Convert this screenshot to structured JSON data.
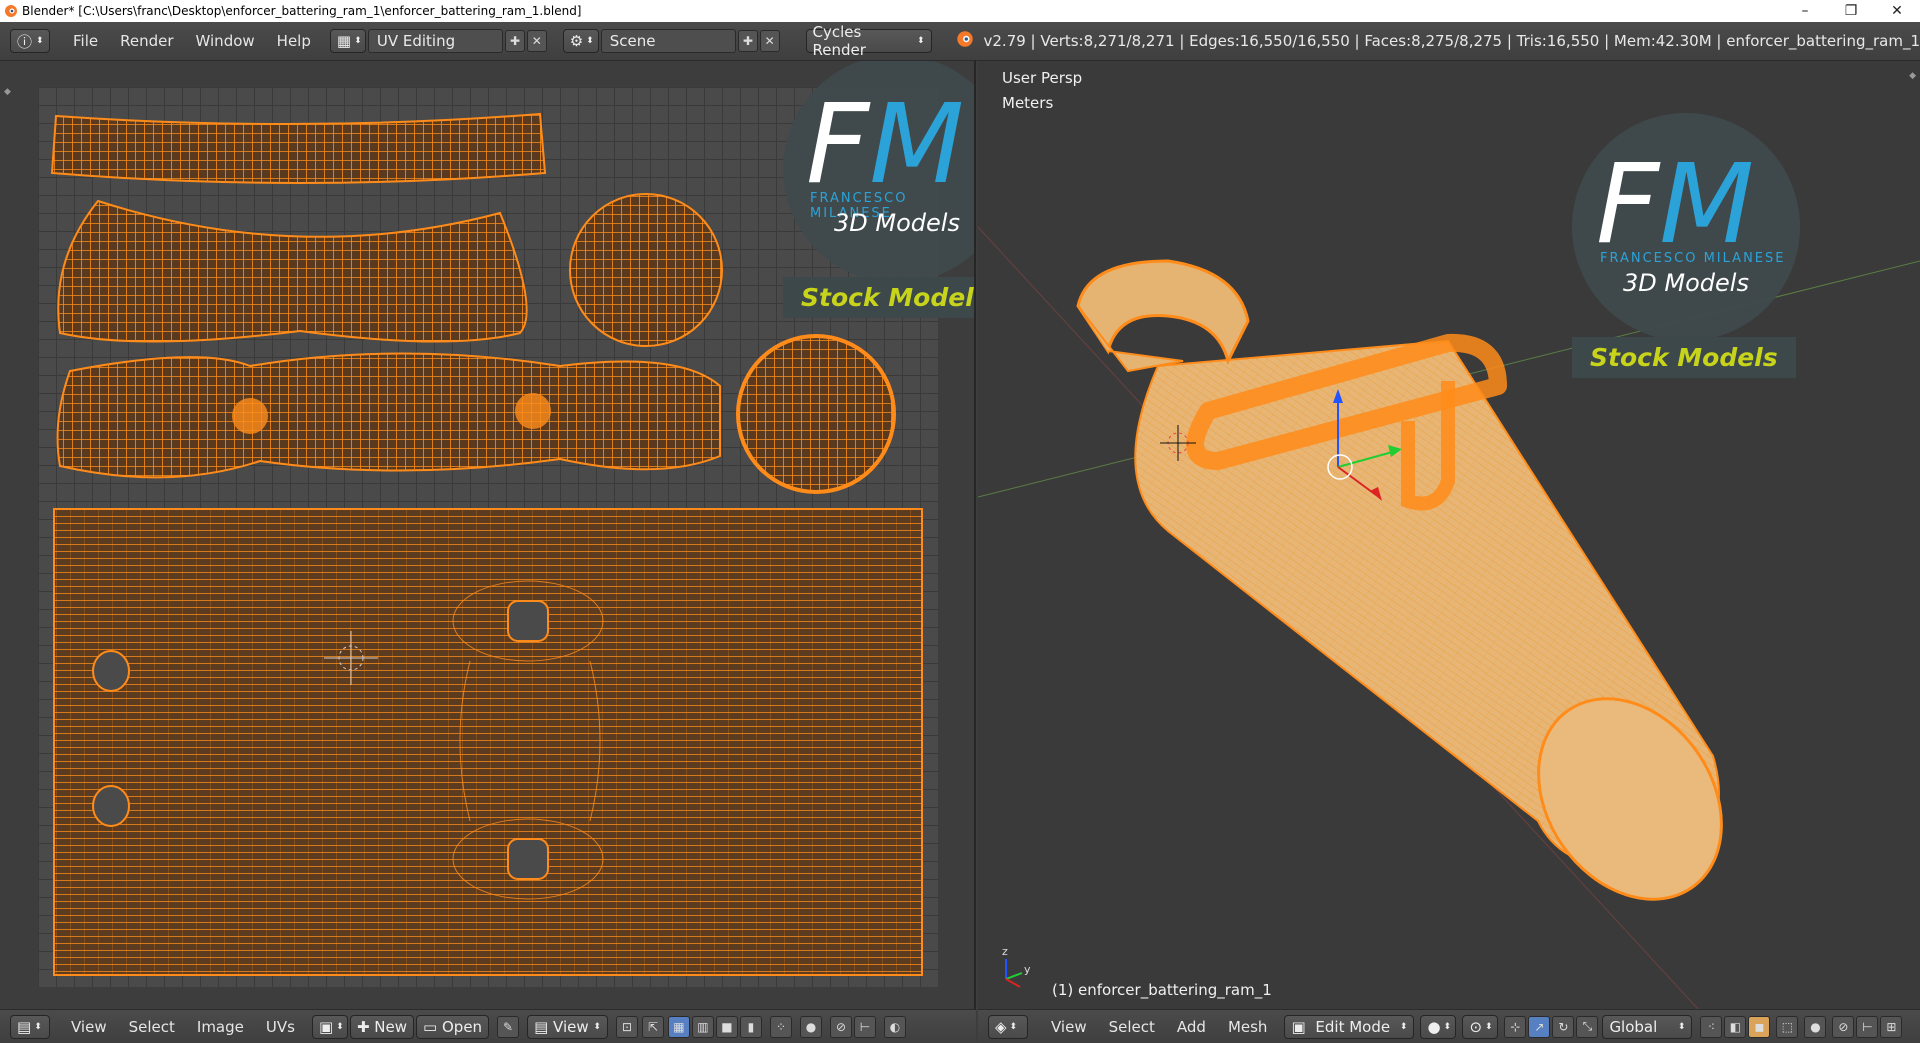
{
  "window": {
    "title": "Blender* [C:\\Users\\franc\\Desktop\\enforcer_battering_ram_1\\enforcer_battering_ram_1.blend]",
    "controls": [
      "–",
      "❐",
      "✕"
    ]
  },
  "topbar": {
    "menus": [
      "File",
      "Render",
      "Window",
      "Help"
    ],
    "screen_layout": "UV Editing",
    "scene": "Scene",
    "render_engine": "Cycles Render",
    "stats": "v2.79 | Verts:8,271/8,271 | Edges:16,550/16,550 | Faces:8,275/8,275 | Tris:16,550 | Mem:42.30M | enforcer_battering_ram_1"
  },
  "uv_editor": {
    "menus": [
      "View",
      "Select",
      "Image",
      "UVs"
    ],
    "new_label": "New",
    "open_label": "Open",
    "view_label": "View"
  },
  "viewport": {
    "view_name": "User Persp",
    "units": "Meters",
    "object_label": "(1) enforcer_battering_ram_1",
    "menus": [
      "View",
      "Select",
      "Add",
      "Mesh"
    ],
    "mode": "Edit Mode",
    "orientation": "Global"
  },
  "watermark": {
    "letters": "FM",
    "name": "FRANCESCO MILANESE",
    "subtitle": "3D Models",
    "badge": "Stock Models"
  },
  "colors": {
    "mesh_orange": "#ff8c1a",
    "mesh_light": "#e8b877",
    "logo_blue": "#2ba3d8",
    "badge_yellow": "#c7d41b"
  }
}
